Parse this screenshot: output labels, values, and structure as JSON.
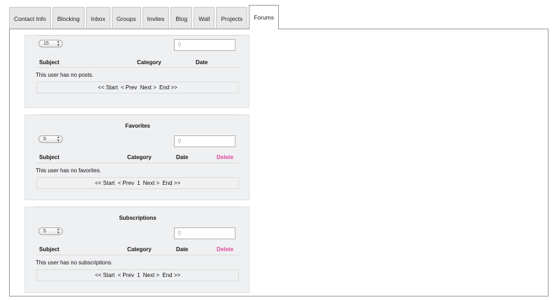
{
  "tabs": [
    {
      "label": "Contact Info"
    },
    {
      "label": "Blocking"
    },
    {
      "label": "Inbox"
    },
    {
      "label": "Groups"
    },
    {
      "label": "Invites"
    },
    {
      "label": "Blog"
    },
    {
      "label": "Wall"
    },
    {
      "label": "Projects"
    },
    {
      "label": "Forums",
      "active": true
    }
  ],
  "posts": {
    "page_size": "15",
    "columns": {
      "subject": "Subject",
      "category": "Category",
      "date": "Date"
    },
    "empty_text": "This user has no posts.",
    "pager": {
      "start": "<< Start",
      "prev": "< Prev",
      "next": "Next >",
      "end": "End >>"
    }
  },
  "favorites": {
    "title": "Favorites",
    "page_size": "5",
    "columns": {
      "subject": "Subject",
      "category": "Category",
      "date": "Date",
      "delete": "Delete"
    },
    "empty_text": "This user has no favorites.",
    "pager": {
      "start": "<< Start",
      "prev": "< Prev",
      "page": "1",
      "next": "Next >",
      "end": "End >>"
    }
  },
  "subscriptions": {
    "title": "Subscriptions",
    "page_size": "5",
    "columns": {
      "subject": "Subject",
      "category": "Category",
      "date": "Date",
      "delete": "Delete"
    },
    "empty_text": "This user has no subscriptions.",
    "pager": {
      "start": "<< Start",
      "prev": "< Prev",
      "page": "1",
      "next": "Next >",
      "end": "End >>"
    }
  },
  "colors": {
    "delete_link": "#e0479e",
    "section_bg": "#eff0f2",
    "tab_bg": "#e7e7e7"
  },
  "icons": {
    "search": "magnifier-icon",
    "select_arrows": "updown-arrows-icon"
  }
}
